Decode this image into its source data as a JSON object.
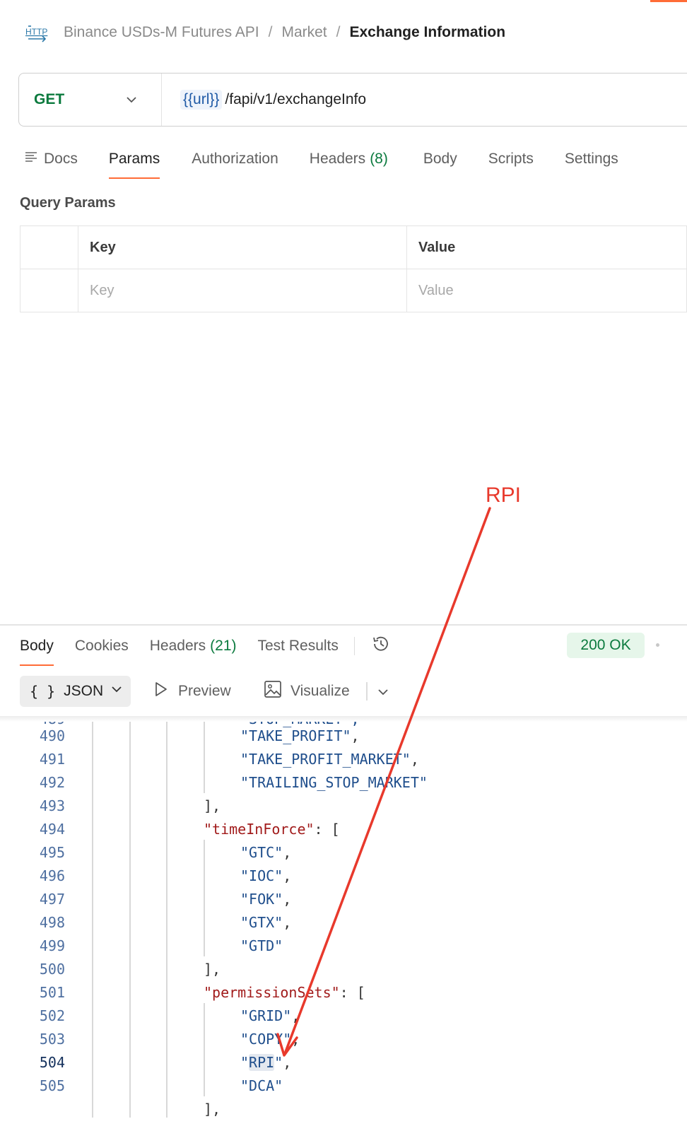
{
  "breadcrumb": {
    "icon": "http-icon",
    "items": [
      "Binance USDs-M Futures API",
      "Market"
    ],
    "separator": "/",
    "current": "Exchange Information"
  },
  "request": {
    "method": "GET",
    "url_variable": "{{url}}",
    "url_path": "/fapi/v1/exchangeInfo"
  },
  "request_tabs": [
    {
      "label": "Docs"
    },
    {
      "label": "Params",
      "active": true
    },
    {
      "label": "Authorization"
    },
    {
      "label": "Headers",
      "count": "(8)"
    },
    {
      "label": "Body"
    },
    {
      "label": "Scripts"
    },
    {
      "label": "Settings"
    }
  ],
  "query_params": {
    "title": "Query Params",
    "header": {
      "key": "Key",
      "value": "Value"
    },
    "placeholder": {
      "key": "Key",
      "value": "Value"
    }
  },
  "response": {
    "tabs": [
      {
        "label": "Body",
        "active": true
      },
      {
        "label": "Cookies"
      },
      {
        "label": "Headers",
        "count": "(21)"
      },
      {
        "label": "Test Results"
      }
    ],
    "status": "200 OK",
    "format": {
      "braces": "{ }",
      "label": "JSON"
    },
    "preview_label": "Preview",
    "visualize_label": "Visualize"
  },
  "code_lines": [
    {
      "num": "490",
      "text": "\"TAKE_PROFIT\"",
      "suffix": ","
    },
    {
      "num": "491",
      "text": "\"TAKE_PROFIT_MARKET\"",
      "suffix": ","
    },
    {
      "num": "492",
      "text": "\"TRAILING_STOP_MARKET\"",
      "suffix": ""
    },
    {
      "num": "493",
      "text": "],"
    },
    {
      "num": "494",
      "key": "\"timeInForce\"",
      "rest": ": ["
    },
    {
      "num": "495",
      "text": "\"GTC\"",
      "suffix": ","
    },
    {
      "num": "496",
      "text": "\"IOC\"",
      "suffix": ","
    },
    {
      "num": "497",
      "text": "\"FOK\"",
      "suffix": ","
    },
    {
      "num": "498",
      "text": "\"GTX\"",
      "suffix": ","
    },
    {
      "num": "499",
      "text": "\"GTD\"",
      "suffix": ""
    },
    {
      "num": "500",
      "text": "],"
    },
    {
      "num": "501",
      "key": "\"permissionSets\"",
      "rest": ": ["
    },
    {
      "num": "502",
      "text": "\"GRID\"",
      "suffix": ","
    },
    {
      "num": "503",
      "text": "\"COPY\"",
      "suffix": ","
    },
    {
      "num": "504",
      "q1": "\"",
      "hl": "RPI",
      "q2": "\"",
      "suffix": ","
    },
    {
      "num": "505",
      "text": "\"DCA\"",
      "suffix": ""
    }
  ],
  "annotation": {
    "label": "RPI",
    "color": "#e8392c"
  },
  "colors": {
    "accent": "#ff6c37",
    "method_get": "#0b7a3e",
    "status_ok_bg": "#e6f6ea",
    "annotation": "#e8392c"
  }
}
